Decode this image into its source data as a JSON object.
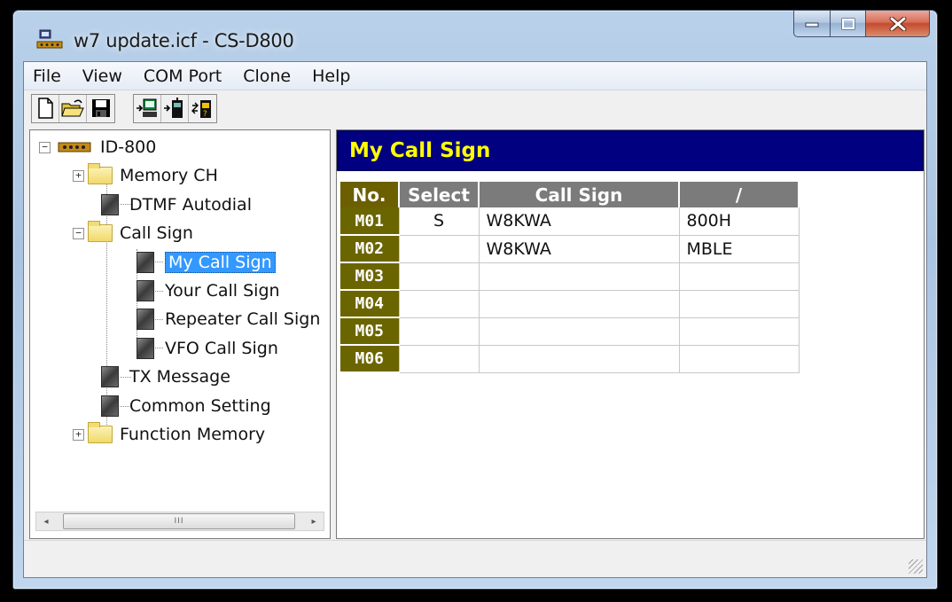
{
  "window": {
    "title": "w7 update.icf - CS-D800"
  },
  "menu": [
    "File",
    "View",
    "COM Port",
    "Clone",
    "Help"
  ],
  "toolbar": {
    "buttons": [
      "new-file-icon",
      "open-folder-icon",
      "save-disk-icon",
      "read-from-radio-icon",
      "write-to-radio-icon",
      "clone-radio-icon"
    ]
  },
  "tree": {
    "root": "ID-800",
    "memory_ch": "Memory CH",
    "dtmf": "DTMF Autodial",
    "call_sign": "Call Sign",
    "my_call_sign": "My Call Sign",
    "your_call_sign": "Your Call Sign",
    "repeater_call_sign": "Repeater Call Sign",
    "vfo_call_sign": "VFO Call Sign",
    "tx_message": "TX Message",
    "common_setting": "Common Setting",
    "function_memory": "Function Memory",
    "scroll_thumb": "III"
  },
  "panel": {
    "title": "My Call Sign",
    "columns": [
      "No.",
      "Select",
      "Call Sign",
      "/"
    ],
    "rows": [
      {
        "no": "M01",
        "select": "S",
        "call": "W8KWA",
        "suffix": "800H"
      },
      {
        "no": "M02",
        "select": "",
        "call": "W8KWA",
        "suffix": "MBLE"
      },
      {
        "no": "M03",
        "select": "",
        "call": "",
        "suffix": ""
      },
      {
        "no": "M04",
        "select": "",
        "call": "",
        "suffix": ""
      },
      {
        "no": "M05",
        "select": "",
        "call": "",
        "suffix": ""
      },
      {
        "no": "M06",
        "select": "",
        "call": "",
        "suffix": ""
      }
    ]
  },
  "colors": {
    "header_bg": "#000080",
    "header_text": "#ffff00",
    "row_header_bg": "#6b6500",
    "selection": "#3399ff"
  }
}
